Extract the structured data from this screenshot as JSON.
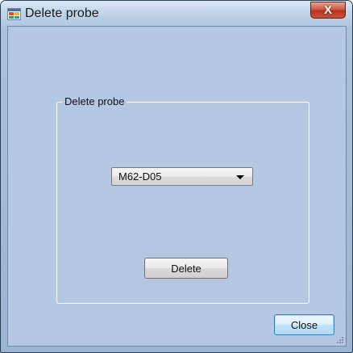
{
  "window": {
    "title": "Delete probe",
    "close_glyph": "X"
  },
  "icons": {
    "app": "app-window-icon",
    "close": "close-icon",
    "dropdown": "chevron-down-icon",
    "resize": "resize-grip-icon"
  },
  "groupbox": {
    "label": "Delete probe"
  },
  "probe_select": {
    "value": "M62-D05"
  },
  "buttons": {
    "delete_label": "Delete",
    "close_label": "Close"
  },
  "colors": {
    "client_background": "#b4c8e3",
    "titlebar_close": "#c9533b",
    "default_button_border": "#3c7fb1"
  }
}
